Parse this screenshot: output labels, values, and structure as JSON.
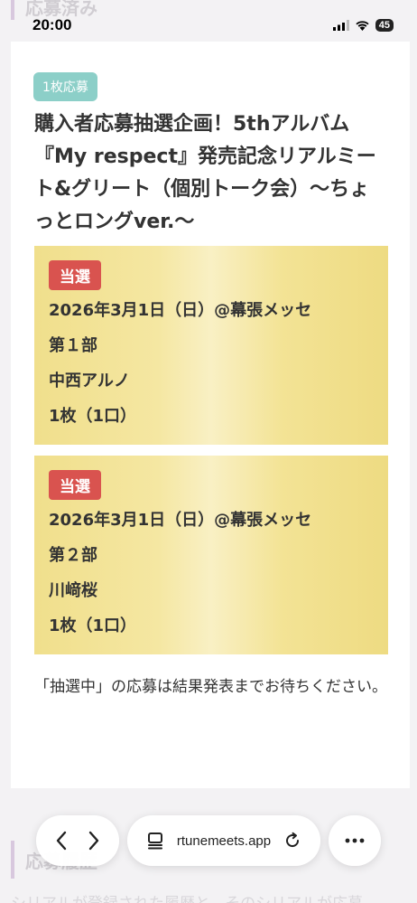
{
  "header": {
    "section_title": "応募済み"
  },
  "status_bar": {
    "time": "20:00",
    "battery": "45"
  },
  "entry": {
    "count_badge": "1枚応募",
    "title": "購入者応募抽選企画！5thアルバム『My respect』発売記念リアルミート&グリート（個別トーク会）〜ちょっとロングver.〜",
    "results": [
      {
        "status": "当選",
        "date_venue": "2026年3月1日（日）@幕張メッセ",
        "part": "第１部",
        "member": "中西アルノ",
        "quantity": "1枚（1口）"
      },
      {
        "status": "当選",
        "date_venue": "2026年3月1日（日）@幕張メッセ",
        "part": "第２部",
        "member": "川﨑桜",
        "quantity": "1枚（1口）"
      }
    ],
    "note": "「抽選中」の応募は結果発表までお待ちください。"
  },
  "history": {
    "section_title": "応募履歴",
    "description": "シリアルが登録された履歴と、そのシリアルが応募"
  },
  "browser": {
    "url": "rtunemeets.app",
    "icons": [
      "back-icon",
      "forward-icon",
      "tabs-icon",
      "reload-icon",
      "more-icon"
    ]
  },
  "colors": {
    "win_badge": "#d9534f",
    "count_badge": "#8ccfc8",
    "result_bg": "#f3e395"
  }
}
